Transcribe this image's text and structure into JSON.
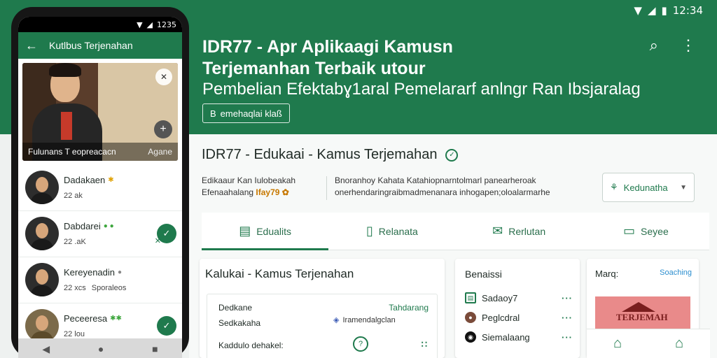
{
  "status_bar": {
    "time": "12:34",
    "signal": "▼",
    "wifi": "▲",
    "battery": "▮"
  },
  "header": {
    "title_line1": "IDR77 - Apr Aplikaagi Kamusn",
    "title_line2": "Terjemanhan Terbaik utour",
    "subtitle": "Pembelian Efektabɣ1aral Pemelararf anlngr Ran Ibsjaralag",
    "chip_label": "emehaqlai klaß",
    "search_icon": "search-icon",
    "more_icon": "more-vert-icon"
  },
  "app": {
    "name": "IDR77 - Edukaai - Kamus Terjemahan",
    "desc_left_1": "Edikaaur Kan Iulobeakah",
    "desc_left_2": "Efenaahalang",
    "desc_left_highlight": "Ifay79 ✿",
    "desc_mid_1": "Bnoranhoy Kahata Katahiopnarntolmarl panearheroak",
    "desc_mid_2": "onerhendaringraibmadmenanara inhogapen;oloalarmarhe",
    "dropdown_label": "Kedunatha"
  },
  "tabs": [
    {
      "label": "Edualits",
      "icon": "document-icon"
    },
    {
      "label": "Relanata",
      "icon": "tablet-icon"
    },
    {
      "label": "Rerlutan",
      "icon": "mail-icon"
    },
    {
      "label": "Seyee",
      "icon": "chat-icon"
    }
  ],
  "card_main": {
    "title": "Kalukai - Kamus Terjenahan",
    "row1_left": "Dedkane",
    "row1_right": "Tahdarang",
    "row2_left": "Sedkakaha",
    "row2_mid": "Iramendalgclan",
    "row3_left": "Kaddulo dehakel:",
    "row3_right": "∷"
  },
  "card_lang": {
    "title": "Benaissi",
    "items": [
      {
        "label": "Sadaoy7",
        "dots": "···"
      },
      {
        "label": "Peglcdral",
        "dots": "···"
      },
      {
        "label": "Siemalaang",
        "dots": "···"
      }
    ]
  },
  "card_promo": {
    "label": "Marq:",
    "link": "Soaching",
    "thumb_text": "TERJEMAH"
  },
  "phone": {
    "time": "1235",
    "title": "Kutlbus Terjenahan",
    "video_caption_left": "Fulunans  T eopreacacn",
    "video_caption_right": "Agane",
    "contacts": [
      {
        "name": "Dadakaen",
        "status": "✱",
        "meta": "22 ak",
        "meta2": ""
      },
      {
        "name": "Dabdarei",
        "status": "● ●",
        "meta": "22 .aK",
        "meta2": ""
      },
      {
        "name": "Kereyenadin",
        "status": "●",
        "meta": "22 xcs",
        "meta2": "Sporaleos"
      },
      {
        "name": "Peceeresa",
        "status": "✱✱",
        "meta": "22 lou",
        "meta2": ""
      }
    ]
  }
}
